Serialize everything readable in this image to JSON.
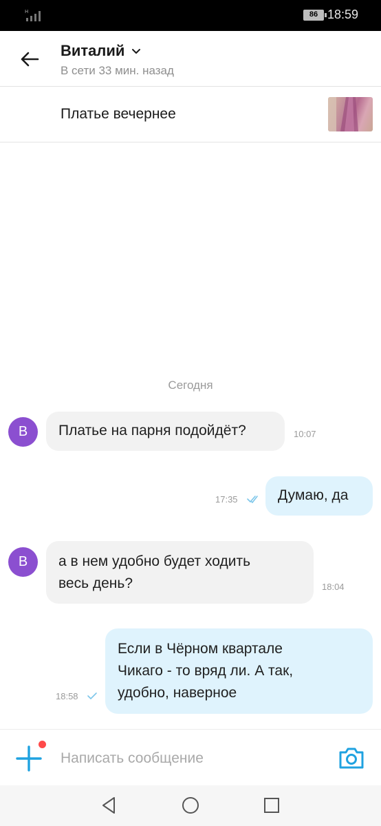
{
  "status_bar": {
    "battery": "86",
    "time": "18:59"
  },
  "header": {
    "name": "Виталий",
    "status": "В сети 33 мин. назад"
  },
  "listing": {
    "title": "Платье вечернее"
  },
  "chat": {
    "date_label": "Сегодня",
    "messages": [
      {
        "direction": "in",
        "avatar_letter": "В",
        "lines": [
          "Платье на парня подойдёт?"
        ],
        "time": "10:07"
      },
      {
        "direction": "out",
        "lines": [
          "Думаю, да"
        ],
        "time": "17:35",
        "status": "read"
      },
      {
        "direction": "in",
        "avatar_letter": "В",
        "lines": [
          "а в нем удобно будет ходить",
          "весь день?"
        ],
        "time": "18:04"
      },
      {
        "direction": "out",
        "lines": [
          "Если в Чёрном квартале",
          "Чикаго - то вряд ли. А так,",
          "удобно, наверное"
        ],
        "time": "18:58",
        "status": "sent"
      }
    ]
  },
  "composer": {
    "placeholder": "Написать сообщение"
  },
  "icons": {
    "back": "arrow-left-icon",
    "chevron": "chevron-down-icon",
    "plus": "plus-icon",
    "camera": "camera-icon",
    "read_receipt": "double-check-icon",
    "sent_receipt": "check-icon",
    "nav_back": "triangle-back-icon",
    "nav_home": "circle-home-icon",
    "nav_recent": "square-recent-icon"
  },
  "colors": {
    "accent": "#1fa2e0",
    "avatar": "#8b4fd0",
    "incoming_bubble": "#f2f2f2",
    "outgoing_bubble": "#dff3fd",
    "notification_dot": "#ff4a4a"
  }
}
